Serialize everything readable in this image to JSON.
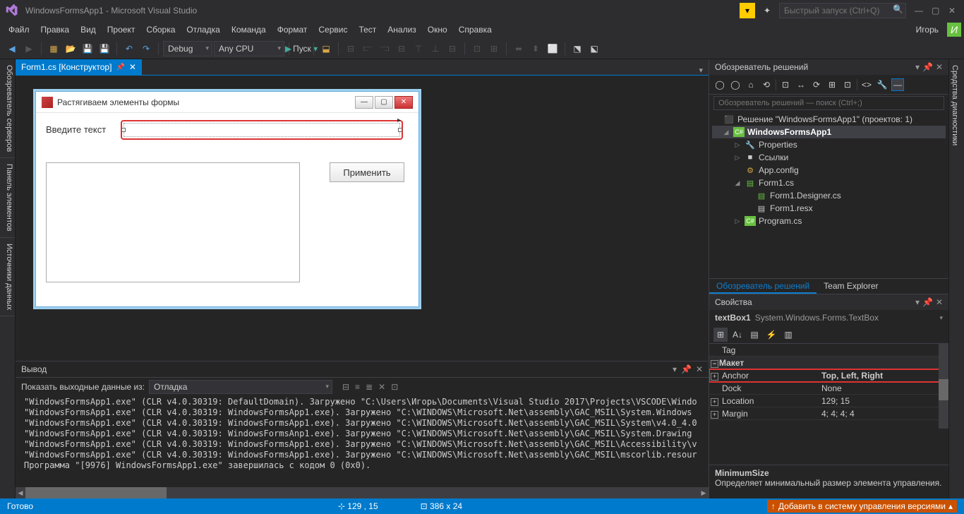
{
  "titlebar": {
    "title": "WindowsFormsApp1 - Microsoft Visual Studio",
    "quickLaunchPlaceholder": "Быстрый запуск (Ctrl+Q)"
  },
  "user": {
    "name": "Игорь",
    "initial": "И"
  },
  "menu": [
    "Файл",
    "Правка",
    "Вид",
    "Проект",
    "Сборка",
    "Отладка",
    "Команда",
    "Формат",
    "Сервис",
    "Тест",
    "Анализ",
    "Окно",
    "Справка"
  ],
  "toolbar": {
    "config": "Debug",
    "platform": "Any CPU",
    "run": "Пуск"
  },
  "leftRail": [
    "Обозреватель серверов",
    "Панель элементов",
    "Источники данных"
  ],
  "rightRail": "Средства диагностики",
  "tab": {
    "name": "Form1.cs [Конструктор]"
  },
  "form": {
    "title": "Растягиваем элементы формы",
    "label": "Введите текст",
    "button": "Применить"
  },
  "output": {
    "title": "Вывод",
    "showFrom": "Показать выходные данные из:",
    "source": "Отладка",
    "lines": [
      "\"WindowsFormsApp1.exe\" (CLR v4.0.30319: DefaultDomain). Загружено \"C:\\Users\\Игорь\\Documents\\Visual Studio 2017\\Projects\\VSCODE\\Windo",
      "\"WindowsFormsApp1.exe\" (CLR v4.0.30319: WindowsFormsApp1.exe). Загружено \"C:\\WINDOWS\\Microsoft.Net\\assembly\\GAC_MSIL\\System.Windows",
      "\"WindowsFormsApp1.exe\" (CLR v4.0.30319: WindowsFormsApp1.exe). Загружено \"C:\\WINDOWS\\Microsoft.Net\\assembly\\GAC_MSIL\\System\\v4.0_4.0",
      "\"WindowsFormsApp1.exe\" (CLR v4.0.30319: WindowsFormsAnp1.exe). Загружено \"C:\\WINDOWS\\Microsoft.Net\\assembly\\GAC_MSIL\\System.Drawing",
      "\"WindowsFormsApp1.exe\" (CLR v4.0.30319: WindowsFormsApp1.exe). Загружено \"C:\\WINDOWS\\Microsoft.Net\\assembly\\GAC_MSIL\\Accessibility\\v",
      "\"WindowsFormsApp1.exe\" (CLR v4.0.30319: WindowsFormsApp1.exe). Загружено \"C:\\WINDOWS\\Microsoft.Net\\assembly\\GAC_MSIL\\mscorlib.resour",
      "Программа \"[9976] WindowsFormsApp1.exe\" завершилась с кодом 0 (0x0)."
    ]
  },
  "solExp": {
    "title": "Обозреватель решений",
    "searchPlaceholder": "Обозреватель решений — поиск (Ctrl+;)",
    "solution": "Решение \"WindowsFormsApp1\"  (проектов: 1)",
    "project": "WindowsFormsApp1",
    "nodes": {
      "properties": "Properties",
      "refs": "Ссылки",
      "appconfig": "App.config",
      "form1": "Form1.cs",
      "designer": "Form1.Designer.cs",
      "resx": "Form1.resx",
      "program": "Program.cs"
    },
    "tabs": {
      "sol": "Обозреватель решений",
      "team": "Team Explorer"
    }
  },
  "props": {
    "title": "Свойства",
    "objName": "textBox1",
    "objType": "System.Windows.Forms.TextBox",
    "rows": {
      "tag": "Tag",
      "catLayout": "Макет",
      "anchor": "Anchor",
      "anchorV": "Top, Left, Right",
      "dock": "Dock",
      "dockV": "None",
      "location": "Location",
      "locationV": "129; 15",
      "margin": "Margin",
      "marginV": "4; 4; 4; 4"
    },
    "help": {
      "title": "MinimumSize",
      "desc": "Определяет минимальный размер элемента управления."
    }
  },
  "status": {
    "ready": "Готово",
    "pos": "129 , 15",
    "size": "386 x 24",
    "vcs": "Добавить в систему управления версиями"
  }
}
